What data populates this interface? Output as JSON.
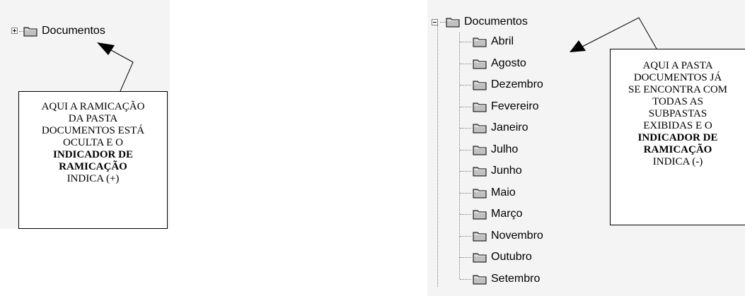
{
  "left_tree": {
    "root": {
      "label": "Documentos",
      "expander": "+",
      "expanded": false
    }
  },
  "left_callout": {
    "lines": [
      "AQUI A RAMICAÇÃO",
      "DA PASTA",
      "DOCUMENTOS ESTÁ",
      "OCULTA E O"
    ],
    "bold_lines": [
      "INDICADOR DE",
      "RAMICAÇÃO"
    ],
    "last_line": "INDICA (+)"
  },
  "right_tree": {
    "root": {
      "label": "Documentos",
      "expander": "-",
      "expanded": true
    },
    "children": [
      "Abril",
      "Agosto",
      "Dezembro",
      "Fevereiro",
      "Janeiro",
      "Julho",
      "Junho",
      "Maio",
      "Março",
      "Novembro",
      "Outubro",
      "Setembro"
    ]
  },
  "right_callout": {
    "lines": [
      "AQUI A PASTA",
      "DOCUMENTOS JÁ",
      "SE ENCONTRA COM",
      "TODAS AS",
      "SUBPASTAS",
      "EXIBIDAS E O"
    ],
    "bold_lines": [
      "INDICADOR DE",
      "RAMICAÇÃO"
    ],
    "last_line": "INDICA (-)"
  },
  "icons": {
    "folder": "folder-icon",
    "expand": "plus-expander-icon",
    "collapse": "minus-expander-icon"
  },
  "colors": {
    "folder_fill": "#c0c0c0",
    "folder_outline": "#000000",
    "tree_lines": "#7f7f7f",
    "panel_bg": "#f4f4f4"
  }
}
